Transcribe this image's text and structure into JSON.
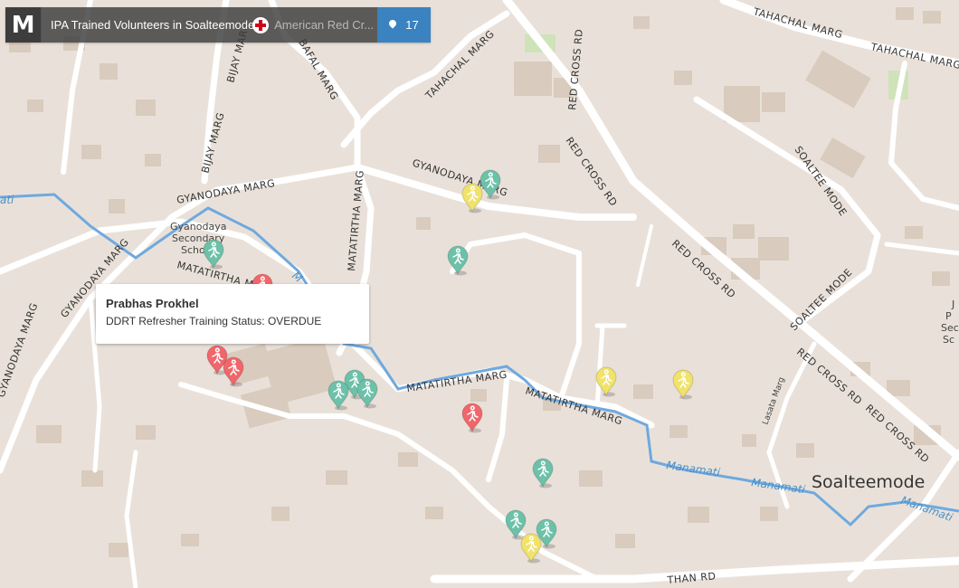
{
  "header": {
    "logo": "M",
    "title": "IPA Trained Volunteers in Soalteemode",
    "subtitle": "American Red Cr...",
    "marker_count": "17",
    "icons": {
      "logo": "m-logo-icon",
      "org": "red-cross-icon",
      "count": "map-pin-icon"
    }
  },
  "popup": {
    "name": "Prabhas Prokhel",
    "status": "DDRT Refresher Training Status: OVERDUE"
  },
  "map_labels": {
    "tahachal_marg": "TAHACHAL MARG",
    "bijay_marg": "BIJAY MARG",
    "bafal_marg": "BAFAL MARG",
    "red_cross_rd": "RED CROSS RD",
    "gyanodaya_marg": "GYANODAYA MARG",
    "gyanodaya_school_1": "Gyanodaya",
    "gyanodaya_school_2": "Secondary",
    "gyanodaya_school_3": "School",
    "matatirtha_marg": "MATATIRTHA MARG",
    "soaltee_mode_road": "SOALTEE MODE",
    "manamati": "Manamati",
    "soalteemode": "Soalteemode",
    "lasata_marg": "Lasata Marg",
    "kathmandu_partial": "THAN RD",
    "right_place_1": "J",
    "right_place_2": "P",
    "right_place_3": "Seco",
    "right_place_4": "Sc"
  },
  "legend_colors": {
    "completed": "#6cc1a8",
    "due": "#f0e26a",
    "overdue": "#f0666a"
  },
  "markers": [
    {
      "status": "completed"
    },
    {
      "status": "due"
    },
    {
      "status": "completed"
    },
    {
      "status": "completed"
    },
    {
      "status": "overdue"
    },
    {
      "status": "overdue"
    },
    {
      "status": "overdue"
    },
    {
      "status": "completed"
    },
    {
      "status": "completed"
    },
    {
      "status": "completed"
    },
    {
      "status": "overdue"
    },
    {
      "status": "due"
    },
    {
      "status": "due"
    },
    {
      "status": "completed"
    },
    {
      "status": "completed"
    },
    {
      "status": "completed"
    },
    {
      "status": "due"
    }
  ]
}
